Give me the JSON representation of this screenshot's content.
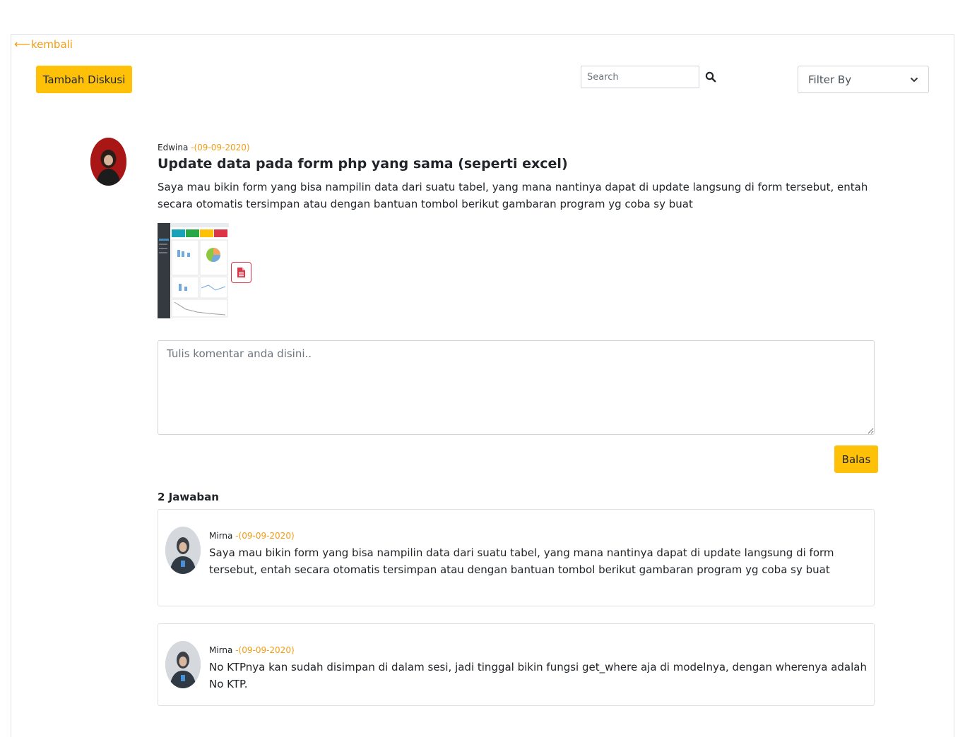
{
  "nav": {
    "back_label": "kembali",
    "back_arrow": "⟵"
  },
  "toolbar": {
    "add_discussion_label": "Tambah Diskusi",
    "search_placeholder": "Search",
    "filter_label": "Filter By"
  },
  "post": {
    "author": "Edwina",
    "date": "-(09-09-2020)",
    "title": "Update data pada form php yang sama (seperti excel)",
    "body": "Saya mau bikin form yang bisa nampilin data dari suatu tabel, yang mana nantinya dapat di update langsung di form tersebut, entah secara otomatis tersimpan atau dengan bantuan tombol berikut gambaran program yg coba sy buat"
  },
  "comment_form": {
    "placeholder": "Tulis komentar anda disini..",
    "reply_label": "Balas"
  },
  "answers": {
    "count_label": "2 Jawaban",
    "items": [
      {
        "author": "Mirna",
        "date": "-(09-09-2020)",
        "text": "Saya mau bikin form yang bisa nampilin data dari suatu tabel, yang mana nantinya dapat di update langsung di form tersebut, entah secara otomatis tersimpan atau dengan bantuan tombol berikut gambaran program yg coba sy buat"
      },
      {
        "author": "Mirna",
        "date": "-(09-09-2020)",
        "text": "No KTPnya kan sudah disimpan di dalam sesi, jadi tinggal bikin fungsi get_where aja di modelnya, dengan wherenya adalah No KTP."
      }
    ]
  },
  "colors": {
    "accent": "#ffc107",
    "date": "#f39c12",
    "file_icon": "#dc3545"
  }
}
